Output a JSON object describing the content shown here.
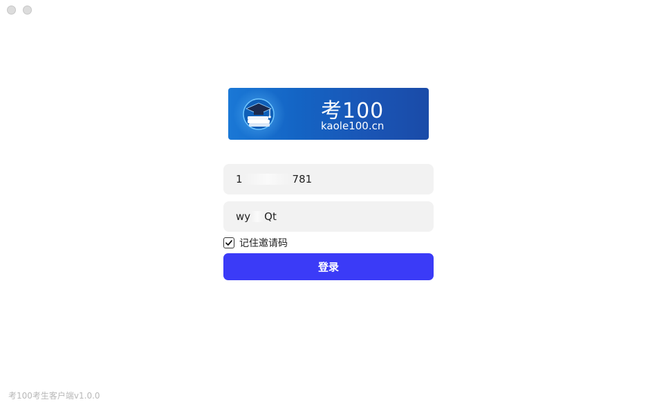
{
  "window": {
    "controls": [
      "close",
      "minimize"
    ]
  },
  "banner": {
    "title": "考100",
    "domain": "kaole100.cn",
    "logo_icon": "graduation-cap-books-icon"
  },
  "form": {
    "phone_prefix": "1",
    "phone_suffix": "781",
    "code_prefix": "wy",
    "code_suffix": "Qt",
    "remember_label": "记住邀请码",
    "remember_checked": true,
    "login_label": "登录"
  },
  "footer": {
    "version": "考100考生客户端v1.0.0"
  },
  "colors": {
    "primary": "#3b3bf7",
    "banner": "#1464c4",
    "input_bg": "#f2f2f2"
  }
}
